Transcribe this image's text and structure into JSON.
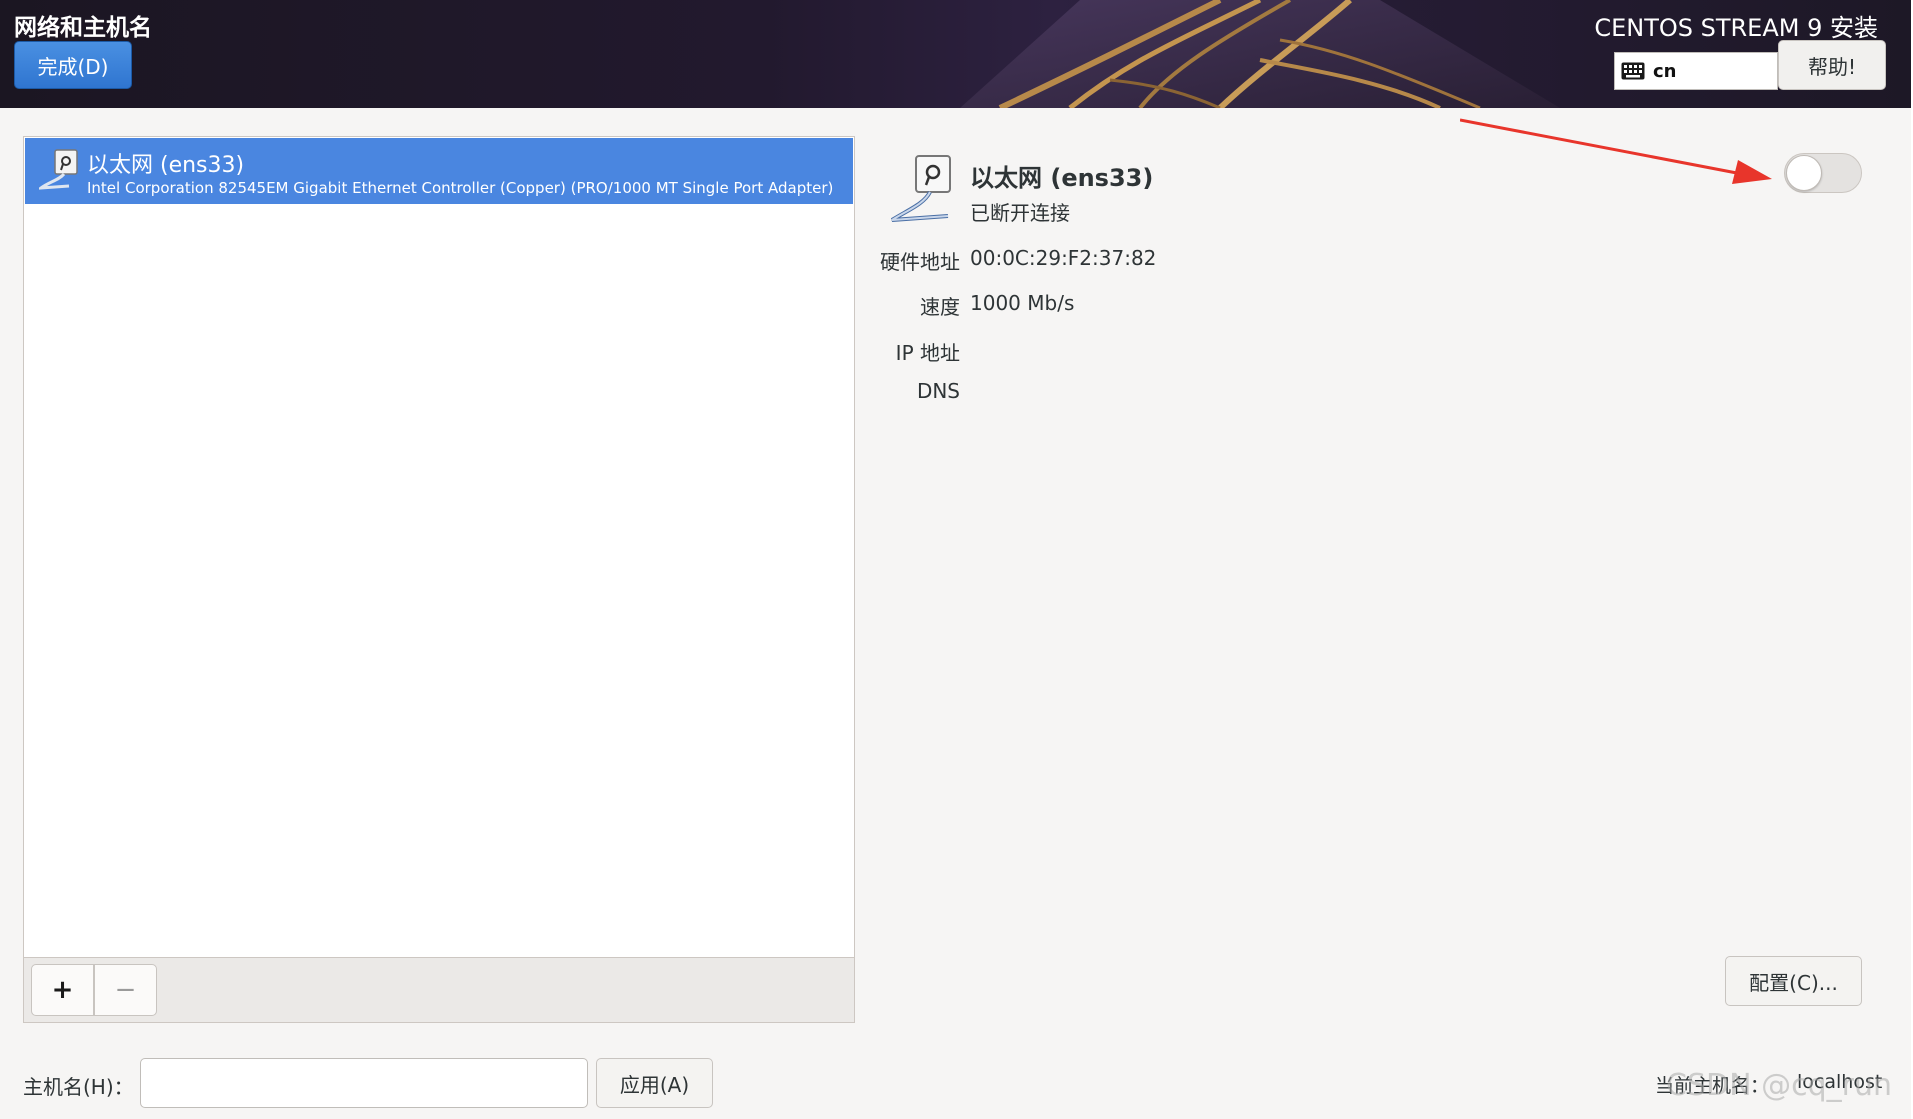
{
  "header": {
    "page_title": "网络和主机名",
    "done_label": "完成(D)",
    "product_title": "CENTOS STREAM 9 安装",
    "keyboard_layout": "cn",
    "help_label": "帮助!"
  },
  "device_list": {
    "items": [
      {
        "name": "以太网 (ens33)",
        "description": "Intel Corporation 82545EM Gigabit Ethernet Controller (Copper) (PRO/1000 MT Single Port Adapter)",
        "selected": true
      }
    ],
    "add_label": "+",
    "remove_label": "−"
  },
  "detail": {
    "name": "以太网 (ens33)",
    "status": "已断开连接",
    "fields": {
      "hw_label": "硬件地址",
      "hw_value": "00:0C:29:F2:37:82",
      "speed_label": "速度",
      "speed_value": "1000 Mb/s",
      "ip_label": "IP 地址",
      "dns_label": "DNS"
    },
    "connection_enabled": false,
    "configure_label": "配置(C)..."
  },
  "hostname": {
    "label": "主机名(H)：",
    "value": "",
    "apply_label": "应用(A)",
    "current_label": "当前主机名：",
    "current_value": "localhost"
  },
  "watermark": "CSDN @cq_run",
  "colors": {
    "selection": "#4a86e0",
    "done_button": "#3b82dc",
    "arrow": "#e8352b"
  },
  "icons": {
    "network": "network-wired-icon",
    "keyboard": "keyboard-icon"
  }
}
